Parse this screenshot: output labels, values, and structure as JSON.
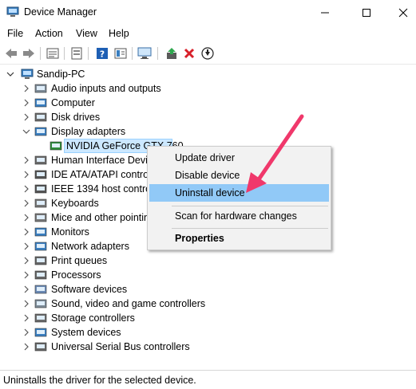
{
  "window": {
    "title": "Device Manager",
    "app_icon": "device-manager-icon"
  },
  "menu": [
    "File",
    "Action",
    "View",
    "Help"
  ],
  "toolbar": {
    "icons": [
      "back-icon",
      "forward-icon",
      "properties-icon",
      "show-hidden-icon",
      "help-icon",
      "view-icon",
      "monitor-scan-icon",
      "update-driver-icon",
      "uninstall-icon",
      "disable-icon"
    ]
  },
  "tree": {
    "root": "Sandip-PC",
    "items": [
      {
        "label": "Audio inputs and outputs",
        "icon": "audio-icon",
        "expanded": false
      },
      {
        "label": "Computer",
        "icon": "computer-icon",
        "expanded": false
      },
      {
        "label": "Disk drives",
        "icon": "disk-icon",
        "expanded": false
      },
      {
        "label": "Display adapters",
        "icon": "display-icon",
        "expanded": true
      },
      {
        "label": "NVIDIA GeForce GTX 760",
        "icon": "gpu-icon",
        "child": true,
        "selected": true
      },
      {
        "label": "Human Interface Devic",
        "icon": "hid-icon",
        "expanded": false
      },
      {
        "label": "IDE ATA/ATAPI control",
        "icon": "ide-icon",
        "expanded": false
      },
      {
        "label": "IEEE 1394 host controll",
        "icon": "firewire-icon",
        "expanded": false
      },
      {
        "label": "Keyboards",
        "icon": "keyboard-icon",
        "expanded": false
      },
      {
        "label": "Mice and other pointin",
        "icon": "mouse-icon",
        "expanded": false
      },
      {
        "label": "Monitors",
        "icon": "monitor-icon",
        "expanded": false
      },
      {
        "label": "Network adapters",
        "icon": "network-icon",
        "expanded": false
      },
      {
        "label": "Print queues",
        "icon": "printer-icon",
        "expanded": false
      },
      {
        "label": "Processors",
        "icon": "cpu-icon",
        "expanded": false
      },
      {
        "label": "Software devices",
        "icon": "software-icon",
        "expanded": false
      },
      {
        "label": "Sound, video and game controllers",
        "icon": "sound-icon",
        "expanded": false
      },
      {
        "label": "Storage controllers",
        "icon": "storage-icon",
        "expanded": false
      },
      {
        "label": "System devices",
        "icon": "system-icon",
        "expanded": false
      },
      {
        "label": "Universal Serial Bus controllers",
        "icon": "usb-icon",
        "expanded": false
      }
    ]
  },
  "context_menu": {
    "items": [
      {
        "label": "Update driver"
      },
      {
        "label": "Disable device"
      },
      {
        "label": "Uninstall device",
        "highlighted": true
      },
      {
        "label": "Scan for hardware changes"
      },
      {
        "label": "Properties",
        "bold": true
      }
    ]
  },
  "status": "Uninstalls the driver for the selected device.",
  "colors": {
    "highlight": "#91c9f7",
    "selection": "#cce8ff",
    "arrow": "#f0386b"
  }
}
